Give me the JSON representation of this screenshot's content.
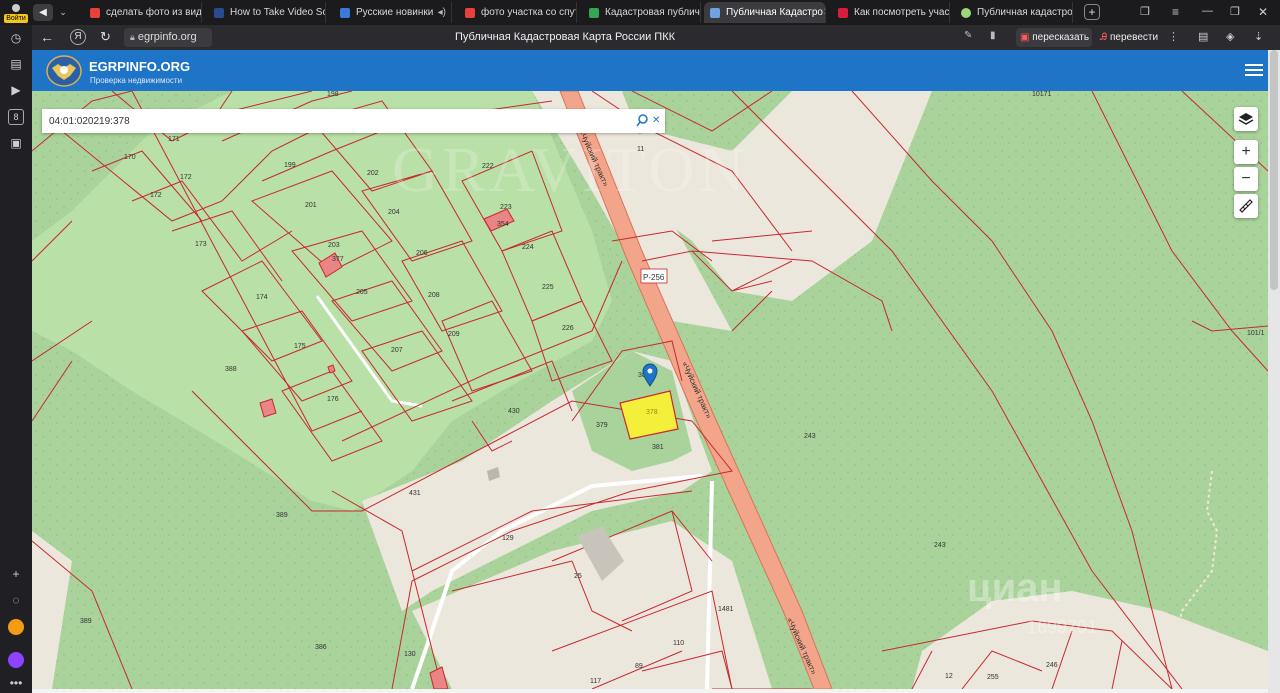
{
  "browser": {
    "profile_label": "Войти",
    "tabs": [
      {
        "title": "сделать фото из видео",
        "color": "#e8413a"
      },
      {
        "title": "How to Take Video Scre",
        "color": "#2a4b8d"
      },
      {
        "title": "Русские новинки",
        "color": "#3a7bd5"
      },
      {
        "title": "фото участка со спутн",
        "color": "#e8413a"
      },
      {
        "title": "Кадастровая публична",
        "color": "#33a852"
      },
      {
        "title": "Публичная Кадастро",
        "color": "#6ea2e0"
      },
      {
        "title": "Как посмотреть участо",
        "color": "#d81d3f"
      },
      {
        "title": "Публичная кадастрова",
        "color": "#9bd77a"
      }
    ],
    "address": "egrpinfo.org",
    "page_title": "Публичная Кадастровая Карта России ПКК",
    "retell_label": "пересказать",
    "translate_label": "перевести"
  },
  "site": {
    "logo_name": "EGRPINFO.ORG",
    "logo_tagline": "Проверка недвижимости"
  },
  "search": {
    "value": "04:01:020219:378"
  },
  "map": {
    "watermark": "GRAVITON",
    "road_label": "Р-256",
    "road_name": "«Чуйский тракт»",
    "cian_watermark": "циан",
    "cian_id": "1699701",
    "labels": [
      "198",
      "10171",
      "171",
      "170",
      "172",
      "172",
      "173",
      "174",
      "175",
      "176",
      "199",
      "201",
      "202",
      "203",
      "204",
      "205",
      "206",
      "207",
      "208",
      "209",
      "222",
      "223",
      "224",
      "225",
      "226",
      "354",
      "377",
      "380",
      "378",
      "379",
      "381",
      "430",
      "431",
      "11",
      "243",
      "243",
      "101/1",
      "388",
      "389",
      "389",
      "386",
      "129",
      "25",
      "130",
      "110",
      "89",
      "117",
      "1481",
      "12",
      "255",
      "246"
    ]
  },
  "colors": {
    "header": "#1e74c7",
    "green": "#a9d39a",
    "road": "#f2a58a",
    "boundary": "#c8282f",
    "selected": "#f3ef3b"
  }
}
